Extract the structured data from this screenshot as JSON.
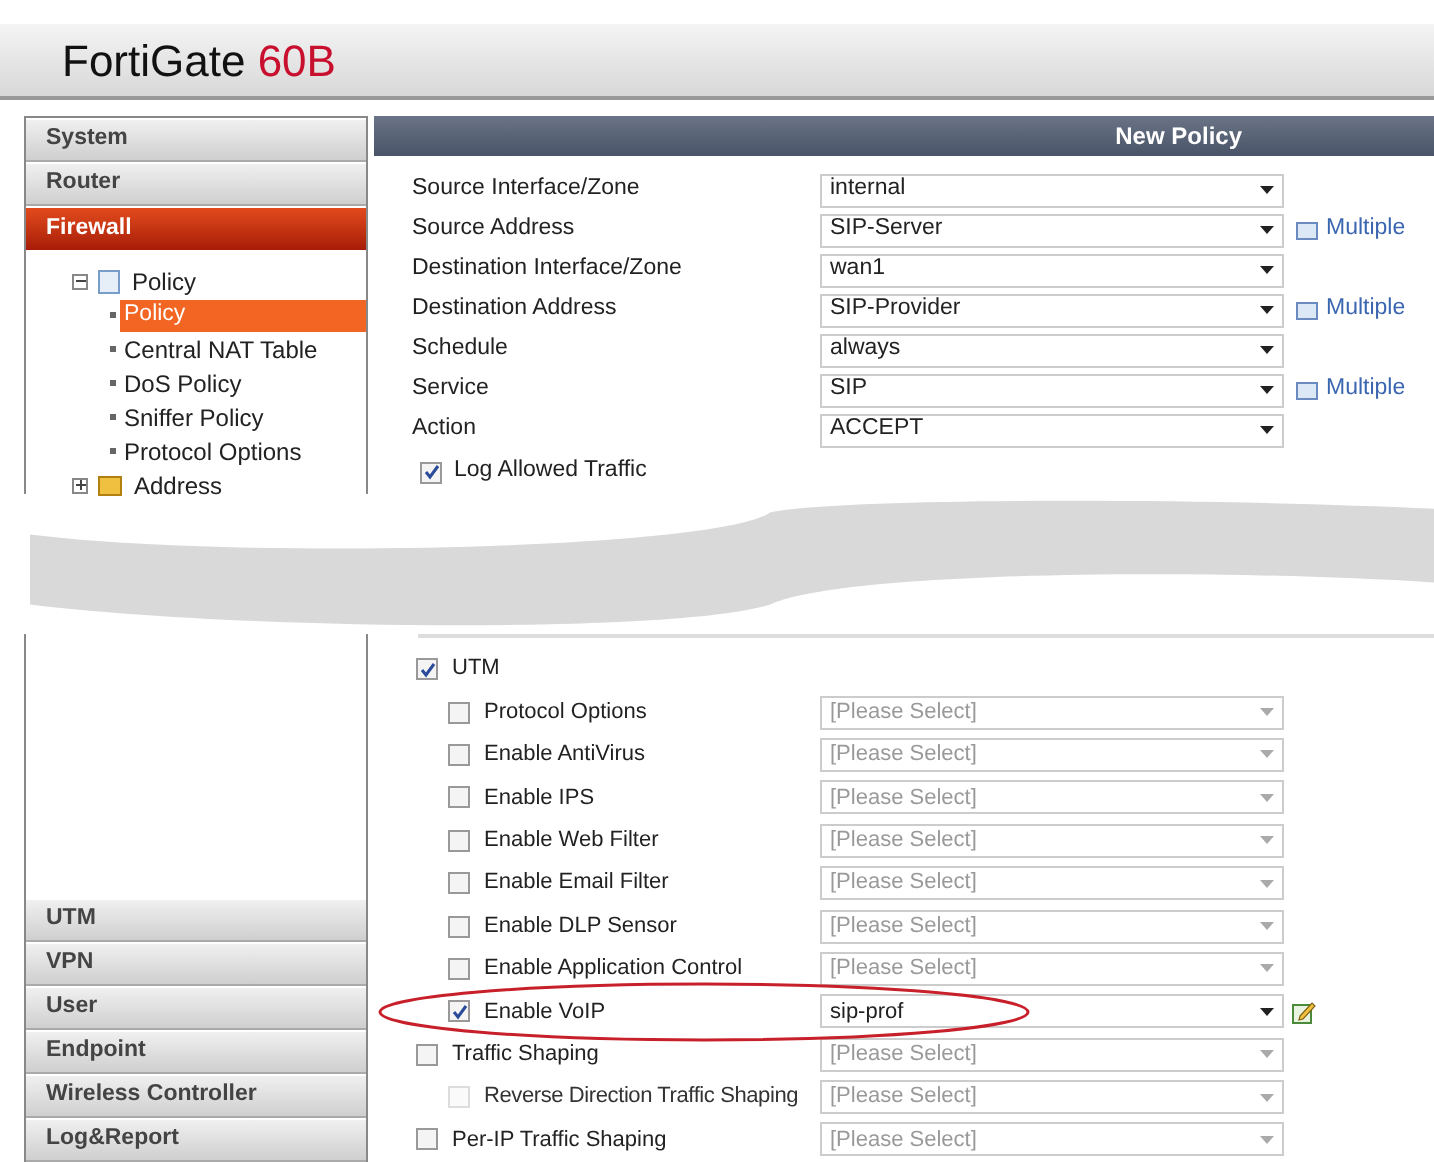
{
  "header": {
    "brand": "FortiGate",
    "model": "60B"
  },
  "sidebar": {
    "menu_top": [
      {
        "label": "System",
        "selected": false
      },
      {
        "label": "Router",
        "selected": false
      },
      {
        "label": "Firewall",
        "selected": true
      }
    ],
    "tree": [
      {
        "label": "Policy",
        "expanded": true,
        "children": [
          {
            "label": "Policy",
            "selected": true
          },
          {
            "label": "Central NAT Table",
            "selected": false
          },
          {
            "label": "DoS Policy",
            "selected": false
          },
          {
            "label": "Sniffer Policy",
            "selected": false
          },
          {
            "label": "Protocol Options",
            "selected": false
          }
        ]
      },
      {
        "label": "Address",
        "expanded": false
      }
    ],
    "menu_bottom": [
      {
        "label": "UTM",
        "selected": false
      },
      {
        "label": "VPN",
        "selected": false
      },
      {
        "label": "User",
        "selected": false
      },
      {
        "label": "Endpoint",
        "selected": false
      },
      {
        "label": "Wireless Controller",
        "selected": false
      },
      {
        "label": "Log&Report",
        "selected": false
      }
    ]
  },
  "panel": {
    "title": "New Policy",
    "fields": [
      {
        "label": "Source Interface/Zone",
        "value": "internal"
      },
      {
        "label": "Source Address",
        "value": "SIP-Server",
        "link": "Multiple"
      },
      {
        "label": "Destination Interface/Zone",
        "value": "wan1"
      },
      {
        "label": "Destination Address",
        "value": "SIP-Provider",
        "link": "Multiple"
      },
      {
        "label": "Schedule",
        "value": "always"
      },
      {
        "label": "Service",
        "value": "SIP",
        "link": "Multiple"
      },
      {
        "label": "Action",
        "value": "ACCEPT"
      }
    ],
    "log_allowed_traffic": {
      "label": "Log Allowed Traffic",
      "checked": true
    },
    "options": [
      {
        "label": "UTM",
        "checked": true,
        "children": [
          {
            "label": "Protocol Options",
            "checked": false,
            "select": {
              "value": "[Please Select]",
              "disabled": true
            }
          },
          {
            "label": "Enable AntiVirus",
            "checked": false,
            "select": {
              "value": "[Please Select]",
              "disabled": true
            }
          },
          {
            "label": "Enable IPS",
            "checked": false,
            "select": {
              "value": "[Please Select]",
              "disabled": true
            }
          },
          {
            "label": "Enable Web Filter",
            "checked": false,
            "select": {
              "value": "[Please Select]",
              "disabled": true
            }
          },
          {
            "label": "Enable Email Filter",
            "checked": false,
            "select": {
              "value": "[Please Select]",
              "disabled": true
            }
          },
          {
            "label": "Enable DLP Sensor",
            "checked": false,
            "select": {
              "value": "[Please Select]",
              "disabled": true
            }
          },
          {
            "label": "Enable Application Control",
            "checked": false,
            "select": {
              "value": "[Please Select]",
              "disabled": true
            }
          },
          {
            "label": "Enable VoIP",
            "checked": true,
            "highlighted": true,
            "edit": true,
            "select": {
              "value": "sip-prof",
              "disabled": false
            }
          }
        ]
      },
      {
        "label": "Traffic Shaping",
        "checked": false,
        "select": {
          "value": "[Please Select]",
          "disabled": true
        },
        "children": [
          {
            "label": "Reverse Direction Traffic Shaping",
            "checked": false,
            "disabled": true,
            "select": {
              "value": "[Please Select]",
              "disabled": true
            }
          }
        ]
      },
      {
        "label": "Per-IP Traffic Shaping",
        "checked": false,
        "select": {
          "value": "[Please Select]",
          "disabled": true
        }
      }
    ]
  }
}
